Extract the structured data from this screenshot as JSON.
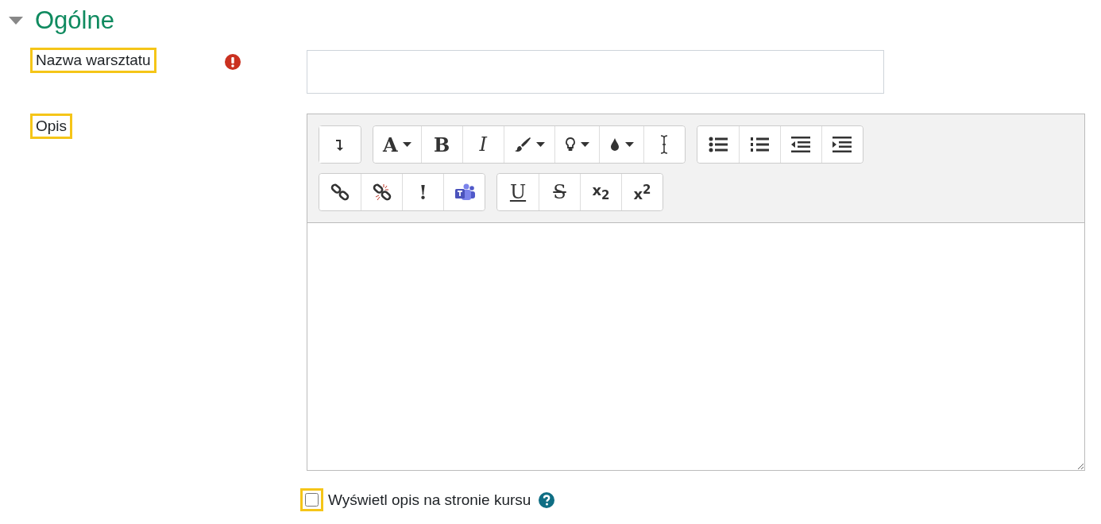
{
  "section": {
    "title": "Ogólne",
    "expanded": true
  },
  "name_field": {
    "label": "Nazwa warsztatu",
    "highlighted": true,
    "required": true
  },
  "description": {
    "label": "Opis",
    "highlighted": true,
    "toolbar_rows": [
      [
        [
          {
            "kind": "collapse"
          }
        ],
        [
          {
            "kind": "font",
            "label": "A",
            "dropdown": true
          },
          {
            "kind": "bold",
            "label": "B"
          },
          {
            "kind": "italic",
            "label": "I"
          },
          {
            "kind": "brush",
            "dropdown": true
          },
          {
            "kind": "bulb",
            "dropdown": true
          },
          {
            "kind": "drop",
            "dropdown": true
          },
          {
            "kind": "cursor"
          }
        ],
        [
          {
            "kind": "bullets"
          },
          {
            "kind": "numbers"
          },
          {
            "kind": "outdent"
          },
          {
            "kind": "indent"
          }
        ]
      ],
      [
        [
          {
            "kind": "link"
          },
          {
            "kind": "unlink"
          },
          {
            "kind": "bold",
            "label": "!"
          },
          {
            "kind": "teams"
          }
        ],
        [
          {
            "kind": "underline",
            "label": "U"
          },
          {
            "kind": "strike",
            "label": "S"
          },
          {
            "kind": "script",
            "label": "x$_{2}$"
          },
          {
            "kind": "script",
            "label": "x$^{2}$"
          }
        ]
      ]
    ]
  },
  "show_on_course": {
    "label": "Wyświetl opis na stronie kursu",
    "checked": false,
    "highlighted": true
  }
}
